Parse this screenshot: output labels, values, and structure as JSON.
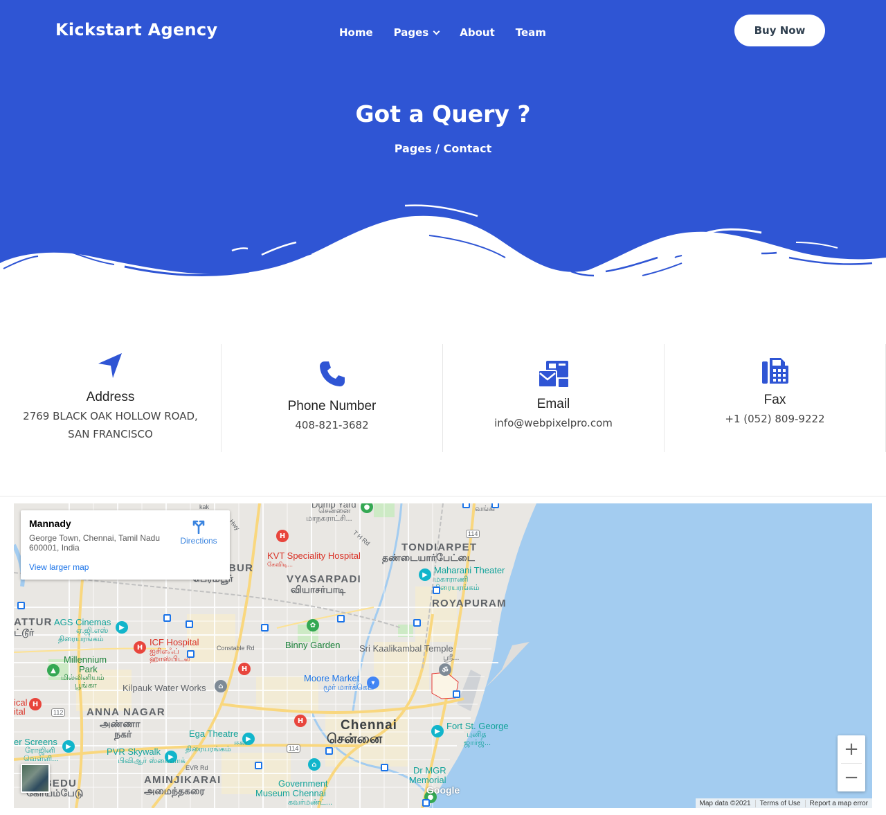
{
  "header": {
    "brand": "Kickstart Agency",
    "nav": [
      "Home",
      "Pages",
      "About",
      "Team"
    ],
    "cta": "Buy Now"
  },
  "hero": {
    "title": "Got a Query ?",
    "breadcrumb": "Pages / Contact"
  },
  "colors": {
    "brand_blue": "#2f55d4",
    "white": "#ffffff",
    "water": "#a3ccf0"
  },
  "contact": [
    {
      "icon": "location-arrow-icon",
      "title": "Address",
      "lines": [
        "2769 BLACK OAK HOLLOW ROAD,",
        "SAN FRANCISCO"
      ]
    },
    {
      "icon": "phone-icon",
      "title": "Phone Number",
      "lines": [
        "408-821-3682"
      ]
    },
    {
      "icon": "mail-bulk-icon",
      "title": "Email",
      "lines": [
        "info@webpixelpro.com"
      ]
    },
    {
      "icon": "fax-icon",
      "title": "Fax",
      "lines": [
        "+1 (052) 809-9222"
      ]
    }
  ],
  "map": {
    "place_name": "Mannady",
    "place_address": "George Town, Chennai, Tamil Nadu 600001, India",
    "directions": "Directions",
    "larger_map": "View larger map",
    "zoom_in": "+",
    "zoom_out": "−",
    "attribution": [
      "Map data ©2021",
      "Terms of Use",
      "Report a map error"
    ],
    "logo": "Google",
    "labels": {
      "tondiarpet": "TONDIARPET",
      "tondiarpet_ta": "தண்டையார்பேட்டை",
      "royapuram": "ROYAPURAM",
      "vyasarpadi": "VYASARPADI",
      "vyasarpadi_ta": "வியாசர்பாடி",
      "perambur_part": "BUR",
      "perambur_ta": "பெரம்பூர்",
      "anna_nagar": "ANNA NAGAR",
      "anna_nagar_ta1": "அண்ணா",
      "anna_nagar_ta2": "நகர்",
      "aminjikarai": "AMINJIKARAI",
      "aminjikarai_ta": "அமைந்தகரை",
      "chennai": "Chennai",
      "chennai_ta": "சென்னை",
      "kvt": "KVT Speciality Hospital",
      "kvt_ta": "கேவிடி...",
      "maharani": "Maharani Theater",
      "maharani_ta1": "மகாராணி",
      "maharani_ta2": "திரையரங்கம்",
      "ags": "AGS Cinemas",
      "ags_ta1": "ஏ.ஜி.எஸ்",
      "ags_ta2": "திரையரங்கம்",
      "icf": "ICF Hospital",
      "icf_ta1": "ஐசிஎஃப்",
      "icf_ta2": "ஹாஸ்பிடல்",
      "binny": "Binny Garden",
      "kaalikambal": "Sri Kaalikambal Temple",
      "kaalikambal_ta": "ஸ்ரீ...",
      "moore": "Moore Market",
      "moore_ta": "மூர் மார்க்கெட்",
      "millennium": "Millennium",
      "millennium2": "Park",
      "millennium_ta1": "மில்லினியம்",
      "millennium_ta2": "பூங்கா",
      "kilpauk": "Kilpauk Water Works",
      "ega": "Ega Theatre",
      "ega_ta1": "ஈகா",
      "ega_ta2": "திரையரங்கம்",
      "pvr": "PVR Skywalk",
      "pvr_ta": "பிவிஆர் ஸ்கைவாக்",
      "screens": "er Screens",
      "screens_ta1": "ரோஜினி",
      "screens_ta2": "வெள்ளி...",
      "fort": "Fort St. George",
      "fort_ta1": "புனித",
      "fort_ta2": "ஜார்ஜ்...",
      "mgr": "Dr MGR",
      "mgr2": "Memorial",
      "museum": "Government",
      "museum2": "Museum Chennai",
      "museum_ta": "கவர்மண்ட்...",
      "attur": "ATTUR",
      "attur_ta": "ட்டூர்",
      "ical": "ical",
      "ital": "ital",
      "ambedu": "AMBEDU",
      "ambedu_ta": "கோயம்பேடு",
      "constable": "Constable Rd",
      "evr": "EVR Rd",
      "th_rd": "T H Rd",
      "dump": "Dump Yard",
      "dump_ta": "சென்னை",
      "dump_ta2": "மாநகராட்சி...",
      "hwy": "Hwy",
      "kak": "kak",
      "vangi": "வங்கி",
      "r112": "112",
      "r114a": "114",
      "r114b": "114"
    }
  }
}
